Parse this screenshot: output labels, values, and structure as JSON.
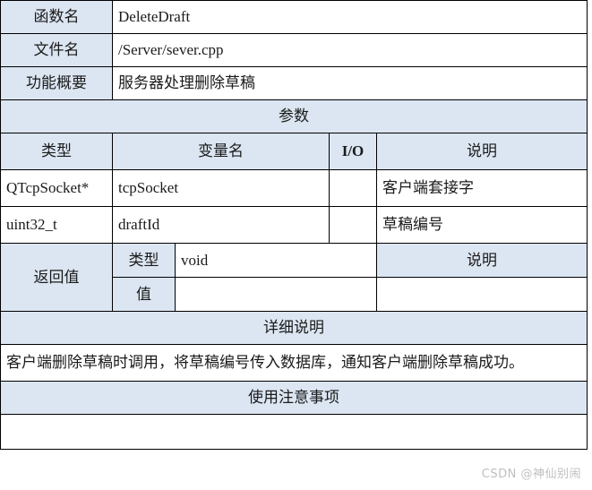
{
  "colors": {
    "shade": "#dce6f2",
    "border": "#000000",
    "text": "#1a1a1a",
    "watermark": "#bfbfbf"
  },
  "header_rows": [
    {
      "label": "函数名",
      "value": "DeleteDraft"
    },
    {
      "label": "文件名",
      "value": "/Server/sever.cpp"
    },
    {
      "label": "功能概要",
      "value": "服务器处理删除草稿"
    }
  ],
  "params_section": {
    "band_title": "参数",
    "columns": [
      "类型",
      "变量名",
      "I/O",
      "说明"
    ],
    "rows": [
      {
        "type": "QTcpSocket*",
        "name": "tcpSocket",
        "io": "",
        "desc": "客户端套接字"
      },
      {
        "type": "uint32_t",
        "name": "draftId",
        "io": "",
        "desc": "草稿编号"
      }
    ]
  },
  "return_section": {
    "label": "返回值",
    "desc_header": "说明",
    "rows": [
      {
        "key": "类型",
        "value": "void",
        "desc": ""
      },
      {
        "key": "值",
        "value": "",
        "desc": ""
      }
    ]
  },
  "detail_section": {
    "band_title": "详细说明",
    "body": "客户端删除草稿时调用，将草稿编号传入数据库，通知客户端删除草稿成功。"
  },
  "notes_section": {
    "band_title": "使用注意事项",
    "body": ""
  },
  "watermark": "CSDN @神仙别闹"
}
